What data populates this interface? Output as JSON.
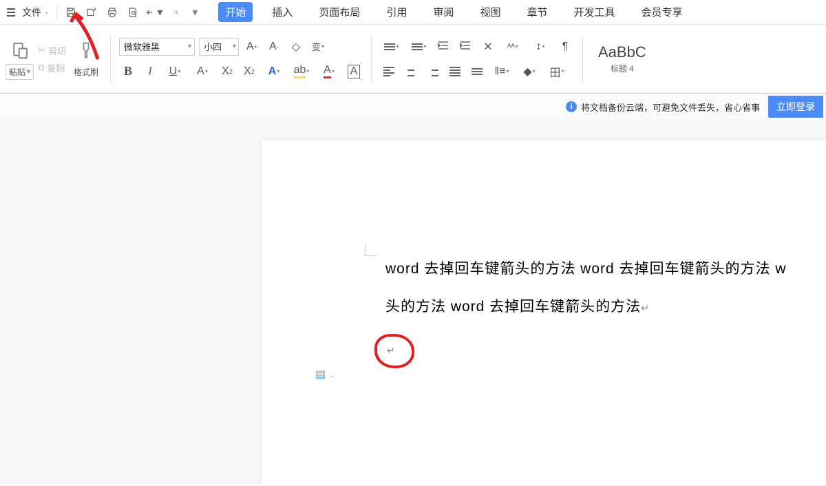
{
  "titlebar": {
    "file_label": "文件",
    "tabs": [
      "开始",
      "插入",
      "页面布局",
      "引用",
      "审阅",
      "视图",
      "章节",
      "开发工具",
      "会员专享"
    ]
  },
  "ribbon": {
    "paste_label": "粘贴",
    "cut_label": "剪切",
    "copy_label": "复制",
    "format_painter_label": "格式刷",
    "font_name": "微软雅黑",
    "font_size": "小四",
    "style_preview": "AaBbC",
    "style_name": "标题 4"
  },
  "notif": {
    "message": "将文档备份云端，可避免文件丢失，省心省事",
    "login_btn": "立即登录"
  },
  "doc": {
    "line1": "word 去掉回车键箭头的方法 word 去掉回车键箭头的方法 w",
    "line2": "头的方法 word 去掉回车键箭头的方法"
  }
}
